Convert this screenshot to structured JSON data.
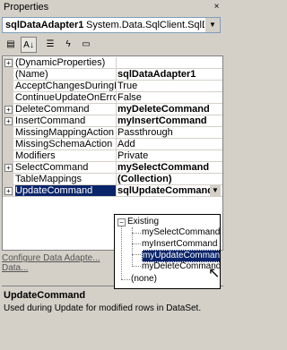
{
  "window": {
    "title": "Properties",
    "close": "×"
  },
  "object_selector": {
    "name": "sqlDataAdapter1",
    "type": "System.Data.SqlClient.SqlDataAd",
    "arrow": "▼"
  },
  "toolbar": [
    "categorized-icon",
    "alphabetical-icon",
    "properties-icon",
    "events-icon",
    "pages-icon"
  ],
  "properties": [
    {
      "name": "(DynamicProperties)",
      "value": "",
      "expandable": true,
      "bold": false
    },
    {
      "name": "(Name)",
      "value": "sqlDataAdapter1",
      "expandable": false,
      "bold": true
    },
    {
      "name": "AcceptChangesDuringFil",
      "value": "True",
      "expandable": false,
      "bold": false
    },
    {
      "name": "ContinueUpdateOnError",
      "value": "False",
      "expandable": false,
      "bold": false
    },
    {
      "name": "DeleteCommand",
      "value": "myDeleteCommand",
      "expandable": true,
      "bold": true
    },
    {
      "name": "InsertCommand",
      "value": "myInsertCommand",
      "expandable": true,
      "bold": true
    },
    {
      "name": "MissingMappingAction",
      "value": "Passthrough",
      "expandable": false,
      "bold": false
    },
    {
      "name": "MissingSchemaAction",
      "value": "Add",
      "expandable": false,
      "bold": false
    },
    {
      "name": "Modifiers",
      "value": "Private",
      "expandable": false,
      "bold": false
    },
    {
      "name": "SelectCommand",
      "value": "mySelectCommand",
      "expandable": true,
      "bold": true
    },
    {
      "name": "TableMappings",
      "value": "(Collection)",
      "expandable": false,
      "bold": true
    },
    {
      "name": "UpdateCommand",
      "value": "sqlUpdateCommand1",
      "expandable": true,
      "bold": true,
      "selected": true
    }
  ],
  "dropdown": {
    "group": "Existing",
    "items": [
      "mySelectCommand",
      "myInsertCommand",
      "myUpdateCommand",
      "myDeleteCommand"
    ],
    "selected_index": 2,
    "none": "(none)"
  },
  "links": [
    "Configure Data Adapte...",
    "Data..."
  ],
  "description": {
    "title": "UpdateCommand",
    "text": "Used during Update for modified rows in DataSet."
  }
}
